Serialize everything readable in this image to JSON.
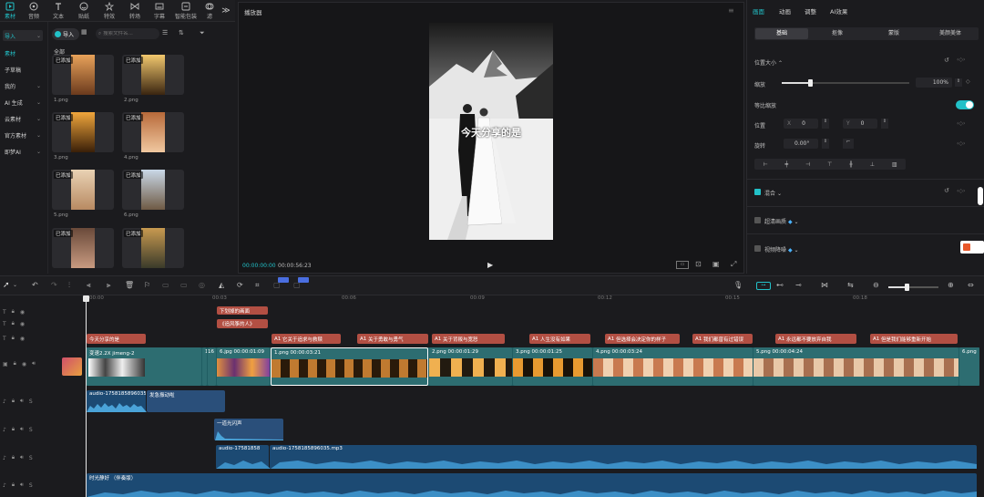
{
  "toolbar": {
    "items": [
      "素材",
      "音频",
      "文本",
      "贴纸",
      "特效",
      "转场",
      "字幕",
      "智能包装",
      "滤"
    ],
    "more": "≫"
  },
  "leftnav": {
    "import": "导入",
    "items": [
      "素材",
      "子草稿",
      "我的",
      "AI 生成",
      "云素材",
      "官方素材",
      "即梦AI"
    ]
  },
  "media": {
    "import_btn": "导入",
    "search_placeholder": "搜索文件名...",
    "section": "全部",
    "added_tag": "已添加",
    "files": [
      "1.png",
      "2.png",
      "3.png",
      "4.png",
      "5.png",
      "6.png",
      "7.png",
      "8.png"
    ]
  },
  "player": {
    "title": "播放器",
    "caption": "今天分享的是",
    "time_current": "00:00:00:00",
    "time_total": "00:00:56:23"
  },
  "rpanel": {
    "tabs": [
      "画面",
      "动画",
      "调整",
      "AI效果"
    ],
    "subtabs": [
      "基础",
      "抠像",
      "蒙版",
      "美颜美体"
    ],
    "pos_size": "位置大小",
    "scale_label": "缩放",
    "scale_value": "100%",
    "scale_fraction": 0.22,
    "ratio_label": "等比缩放",
    "position_label": "位置",
    "pos_x_label": "X",
    "pos_x": "0",
    "pos_y_label": "Y",
    "pos_y": "0",
    "rotate_label": "旋转",
    "rotate_value": "0.00°",
    "blend_label": "混合",
    "superres_label": "超清画质",
    "denoise_label": "视频降噪"
  },
  "timeline": {
    "ticks": [
      "00:00",
      "00:03",
      "00:06",
      "00:09",
      "00:12",
      "00:15",
      "00:18"
    ],
    "text_clips_top": [
      "下划掉的画面",
      "《追风筝的人》"
    ],
    "subtitles": [
      "今天分享的是",
      "它关于追求与救赎",
      "关于勇敢与勇气",
      "关于背叛与宽恕",
      "人生没有如果",
      "但选择会决定你的样子",
      "我们都曾有过错误",
      "永远都不要放弃自我",
      "但是我们能够重新开始"
    ],
    "subtitle_prefix": "A1",
    "video_clips": [
      {
        "label": "变速2.2X  jimeng-2"
      },
      {
        "label": "1"
      },
      {
        "label": "16"
      },
      {
        "label": "6.jpg  00:00:01:09"
      },
      {
        "label": "1.png  00:00:03:21"
      },
      {
        "label": "2.png  00:00:01:29"
      },
      {
        "label": "3.png  00:00:01:25"
      },
      {
        "label": "4.png  00:00:03:24"
      },
      {
        "label": "5.png  00:00:04:24"
      },
      {
        "label": "6.png"
      }
    ],
    "audio_clips": [
      {
        "label": "audio-1758185896035"
      },
      {
        "label": "发急振动啦"
      },
      {
        "label": "一道光闪声"
      },
      {
        "label": "audio-17581858"
      },
      {
        "label": "audio-1758185896035.mp3"
      },
      {
        "label": "时光静好 （伴奏版）"
      }
    ]
  },
  "colors": {
    "accent": "#22c1c8",
    "subtitle": "#b24f43",
    "video": "#1f5d62",
    "audio": "#1c4a73"
  }
}
